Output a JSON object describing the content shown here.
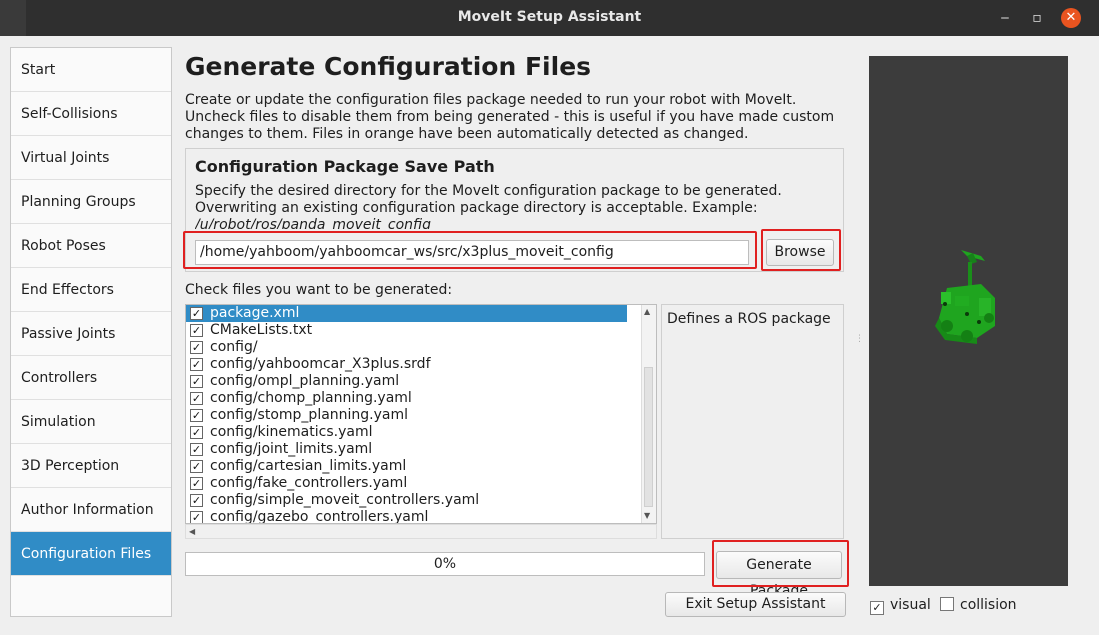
{
  "window": {
    "title": "MoveIt Setup Assistant",
    "minimize": "‒",
    "maximize": "▫",
    "close": "✕"
  },
  "sidebar": {
    "items": [
      {
        "label": "Start"
      },
      {
        "label": "Self-Collisions"
      },
      {
        "label": "Virtual Joints"
      },
      {
        "label": "Planning Groups"
      },
      {
        "label": "Robot Poses"
      },
      {
        "label": "End Effectors"
      },
      {
        "label": "Passive Joints"
      },
      {
        "label": "Controllers"
      },
      {
        "label": "Simulation"
      },
      {
        "label": "3D Perception"
      },
      {
        "label": "Author Information"
      },
      {
        "label": "Configuration Files"
      }
    ],
    "active": "Configuration Files"
  },
  "page": {
    "title": "Generate Configuration Files",
    "description": "Create or update the configuration files package needed to run your robot with MoveIt. Uncheck files to disable them from being generated - this is useful if you have made custom changes to them. Files in orange have been automatically detected as changed."
  },
  "save_path": {
    "heading": "Configuration Package Save Path",
    "description": "Specify the desired directory for the MoveIt configuration package to be generated. Overwriting an existing configuration package directory is acceptable. Example: ",
    "example": "/u/robot/ros/panda_moveit_config",
    "value": "/home/yahboom/yahboomcar_ws/src/x3plus_moveit_config",
    "browse_label": "Browse"
  },
  "files": {
    "label": "Check files you want to be generated:",
    "items": [
      {
        "name": "package.xml",
        "checked": true
      },
      {
        "name": "CMakeLists.txt",
        "checked": true
      },
      {
        "name": "config/",
        "checked": true
      },
      {
        "name": "config/yahboomcar_X3plus.srdf",
        "checked": true
      },
      {
        "name": "config/ompl_planning.yaml",
        "checked": true
      },
      {
        "name": "config/chomp_planning.yaml",
        "checked": true
      },
      {
        "name": "config/stomp_planning.yaml",
        "checked": true
      },
      {
        "name": "config/kinematics.yaml",
        "checked": true
      },
      {
        "name": "config/joint_limits.yaml",
        "checked": true
      },
      {
        "name": "config/cartesian_limits.yaml",
        "checked": true
      },
      {
        "name": "config/fake_controllers.yaml",
        "checked": true
      },
      {
        "name": "config/simple_moveit_controllers.yaml",
        "checked": true
      },
      {
        "name": "config/gazebo_controllers.yaml",
        "checked": true
      }
    ],
    "selected": "package.xml",
    "selected_description": "Defines a ROS package"
  },
  "progress": {
    "text": "0%",
    "value": 0
  },
  "buttons": {
    "generate": "Generate Package",
    "exit": "Exit Setup Assistant"
  },
  "viewer": {
    "visual_label": "visual",
    "visual_checked": true,
    "collision_label": "collision",
    "collision_checked": false
  },
  "colors": {
    "accent": "#308cc6",
    "highlight_box": "#e02020",
    "robot": "#1fa51f",
    "viewer_bg": "#3c3c3c"
  }
}
